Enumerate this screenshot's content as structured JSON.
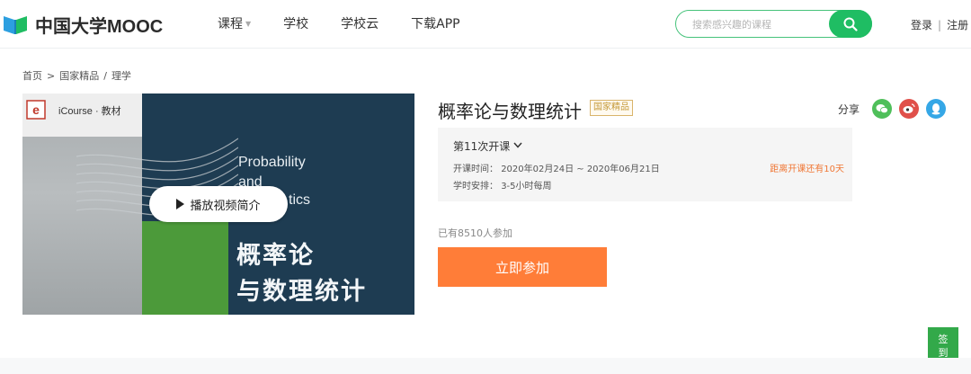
{
  "header": {
    "logo_text": "中国大学MOOC",
    "nav": [
      {
        "label": "课程",
        "has_caret": true
      },
      {
        "label": "学校"
      },
      {
        "label": "学校云"
      },
      {
        "label": "下载APP"
      }
    ],
    "search": {
      "placeholder": "搜索感兴趣的课程",
      "icon": "search-icon"
    },
    "login_label": "登录",
    "separator": "|",
    "register_label": "注册"
  },
  "breadcrumb": {
    "items": [
      "首页",
      ">",
      "国家精品",
      "/",
      "理学"
    ]
  },
  "cover": {
    "logo_text": "iCourse · 教材",
    "en_lines": [
      "Probability",
      "and",
      "tics"
    ],
    "cn_lines": [
      "概率论",
      "与数理统计"
    ],
    "play_label": "播放视频简介"
  },
  "course": {
    "title": "概率论与数理统计",
    "badge": "国家精品",
    "share_label": "分享",
    "share_icons": [
      "wechat-icon",
      "weibo-icon",
      "qq-icon"
    ],
    "colors": {
      "accent": "#1fbd63",
      "join": "#ff7d38",
      "countdown": "#f07735"
    }
  },
  "term": {
    "title": "第11次开课",
    "time_label": "开课时间：",
    "time_value": "2020年02月24日 ~ 2020年06月21日",
    "hours_label": "学时安排：",
    "hours_value": "3-5小时每周",
    "countdown": "距离开课还有10天"
  },
  "enroll": {
    "joined_text": "已有8510人参加",
    "join_label": "立即参加"
  },
  "checkin": {
    "line1": "签",
    "line2": "到"
  }
}
